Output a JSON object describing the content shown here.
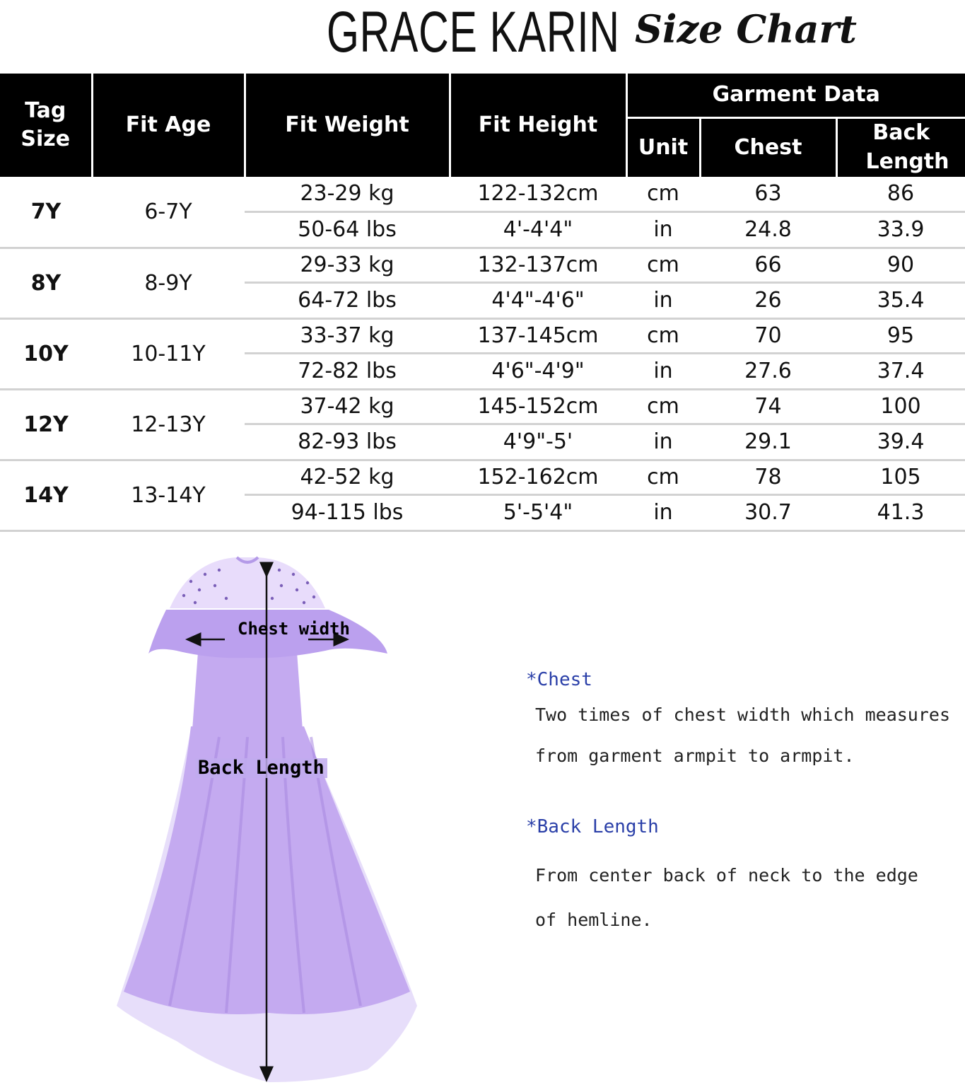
{
  "header": {
    "brand": "GRACE KARIN",
    "title": "Size Chart"
  },
  "table": {
    "headers": {
      "tag_size": "Tag Size",
      "fit_age": "Fit Age",
      "fit_weight": "Fit Weight",
      "fit_height": "Fit Height",
      "garment_data": "Garment Data",
      "unit": "Unit",
      "chest": "Chest",
      "back_length": "Back Length"
    },
    "rows": [
      {
        "tag": "7Y",
        "age": "6-7Y",
        "weight_kg": "23-29 kg",
        "weight_lbs": "50-64 lbs",
        "height_cm": "122-132cm",
        "height_in": "4'-4'4\"",
        "unit_cm": "cm",
        "unit_in": "in",
        "chest_cm": "63",
        "chest_in": "24.8",
        "back_cm": "86",
        "back_in": "33.9"
      },
      {
        "tag": "8Y",
        "age": "8-9Y",
        "weight_kg": "29-33 kg",
        "weight_lbs": "64-72 lbs",
        "height_cm": "132-137cm",
        "height_in": "4'4\"-4'6\"",
        "unit_cm": "cm",
        "unit_in": "in",
        "chest_cm": "66",
        "chest_in": "26",
        "back_cm": "90",
        "back_in": "35.4"
      },
      {
        "tag": "10Y",
        "age": "10-11Y",
        "weight_kg": "33-37 kg",
        "weight_lbs": "72-82 lbs",
        "height_cm": "137-145cm",
        "height_in": "4'6\"-4'9\"",
        "unit_cm": "cm",
        "unit_in": "in",
        "chest_cm": "70",
        "chest_in": "27.6",
        "back_cm": "95",
        "back_in": "37.4"
      },
      {
        "tag": "12Y",
        "age": "12-13Y",
        "weight_kg": "37-42 kg",
        "weight_lbs": "82-93 lbs",
        "height_cm": "145-152cm",
        "height_in": "4'9\"-5'",
        "unit_cm": "cm",
        "unit_in": "in",
        "chest_cm": "74",
        "chest_in": "29.1",
        "back_cm": "100",
        "back_in": "39.4"
      },
      {
        "tag": "14Y",
        "age": "13-14Y",
        "weight_kg": "42-52 kg",
        "weight_lbs": "94-115 lbs",
        "height_cm": "152-162cm",
        "height_in": "5'-5'4\"",
        "unit_cm": "cm",
        "unit_in": "in",
        "chest_cm": "78",
        "chest_in": "30.7",
        "back_cm": "105",
        "back_in": "41.3"
      }
    ]
  },
  "diagram": {
    "chest_label": "Chest width",
    "back_label": "Back Length",
    "dress_color": "#c4aaf0",
    "dress_dark": "#a886e0",
    "tulle_color": "#ddd0f8"
  },
  "notes": {
    "chest_title": "*Chest",
    "chest_line1": "Two times of chest width which measures",
    "chest_line2": "from garment armpit to armpit.",
    "back_title": "*Back Length",
    "back_line1": "From center back of neck to the edge",
    "back_line2": "of hemline."
  }
}
